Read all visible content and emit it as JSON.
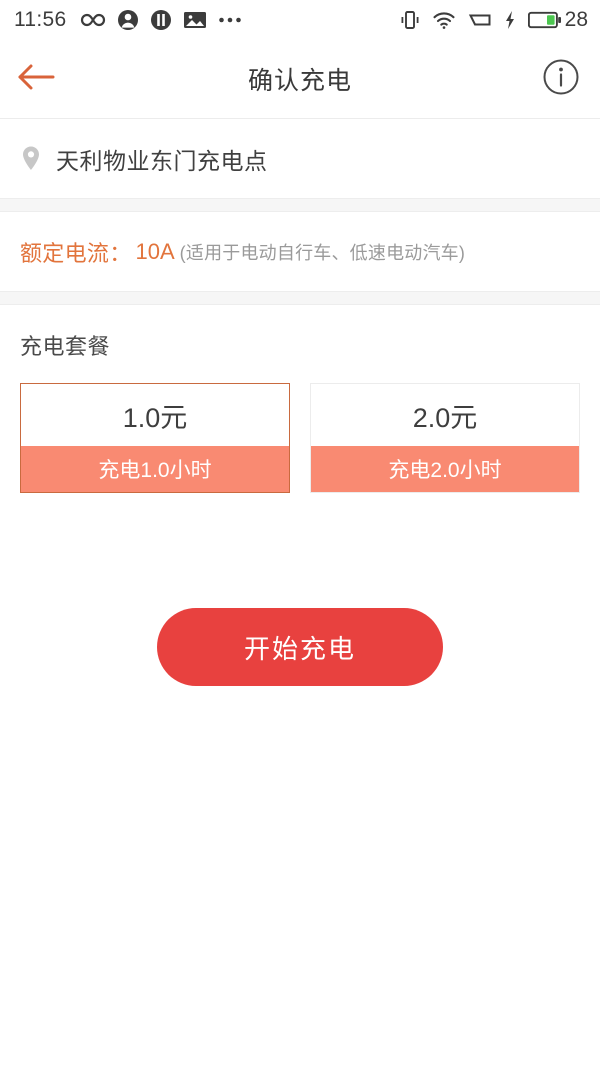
{
  "statusbar": {
    "time": "11:56",
    "left_icons": [
      "infinity-icon",
      "account-icon",
      "music-icon",
      "image-icon",
      "more-icon"
    ],
    "right_icons": [
      "vibrate-icon",
      "wifi-icon",
      "signal-icon",
      "charging-bolt-icon"
    ],
    "battery_percent": "28"
  },
  "header": {
    "back_icon": "back-arrow-icon",
    "title": "确认充电",
    "info_icon": "info-circle-icon",
    "accent_color": "#d9633a"
  },
  "station": {
    "pin_icon": "map-pin-icon",
    "name": "天利物业东门充电点"
  },
  "current": {
    "label": "额定电流：",
    "value": "10A",
    "note": "(适用于电动自行车、低速电动汽车)",
    "color": "#e2743c"
  },
  "packages": {
    "section_title": "充电套餐",
    "items": [
      {
        "price": "1.0元",
        "duration": "充电1.0小时",
        "selected": true
      },
      {
        "price": "2.0元",
        "duration": "充电2.0小时",
        "selected": false
      }
    ],
    "selected_border_color": "#c96a3f",
    "band_color": "#f98a72"
  },
  "cta": {
    "label": "开始充电",
    "color": "#e8413f"
  }
}
